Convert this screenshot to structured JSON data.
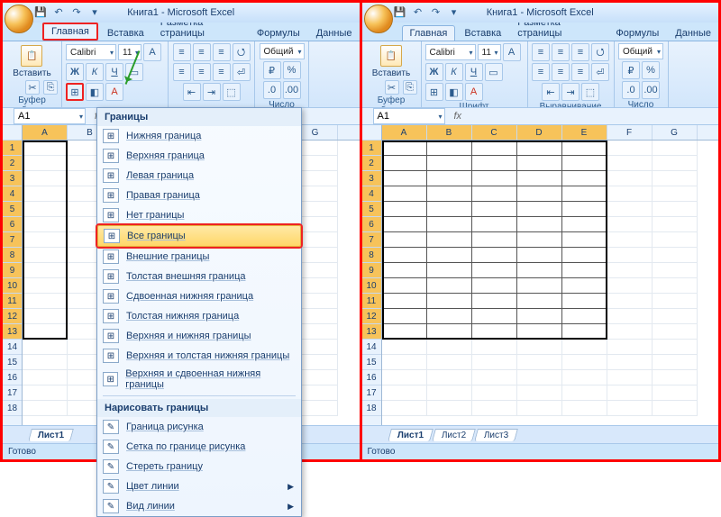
{
  "title": "Книга1 - Microsoft Excel",
  "tabs": {
    "home": "Главная",
    "insert": "Вставка",
    "layout": "Разметка страницы",
    "formulas": "Формулы",
    "data": "Данные"
  },
  "ribbon": {
    "paste": "Вставить",
    "clipboard": "Буфер обмена",
    "font_name": "Calibri",
    "font_size": "11",
    "font": "Шрифт",
    "align": "Выравнивание",
    "number_fmt": "Общий",
    "number": "Число",
    "bold": "Ж",
    "italic": "К",
    "underline": "Ч"
  },
  "name_box": "A1",
  "fx": "fx",
  "cols": [
    "A",
    "B",
    "C",
    "D",
    "E",
    "F",
    "G"
  ],
  "rows": [
    "1",
    "2",
    "3",
    "4",
    "5",
    "6",
    "7",
    "8",
    "9",
    "10",
    "11",
    "12",
    "13",
    "14",
    "15",
    "16",
    "17",
    "18"
  ],
  "borders_menu": {
    "header1": "Границы",
    "items1": [
      "Нижняя граница",
      "Верхняя граница",
      "Левая граница",
      "Правая граница",
      "Нет границы",
      "Все границы",
      "Внешние границы",
      "Толстая внешняя граница",
      "Сдвоенная нижняя граница",
      "Толстая нижняя граница",
      "Верхняя и нижняя границы",
      "Верхняя и толстая нижняя границы",
      "Верхняя и сдвоенная нижняя границы"
    ],
    "hl_index": 5,
    "header2": "Нарисовать границы",
    "items2": [
      "Граница рисунка",
      "Сетка по границе рисунка",
      "Стереть границу",
      "Цвет линии",
      "Вид линии"
    ]
  },
  "sheets": [
    "Лист1",
    "Лист2",
    "Лист3"
  ],
  "status": "Готово"
}
